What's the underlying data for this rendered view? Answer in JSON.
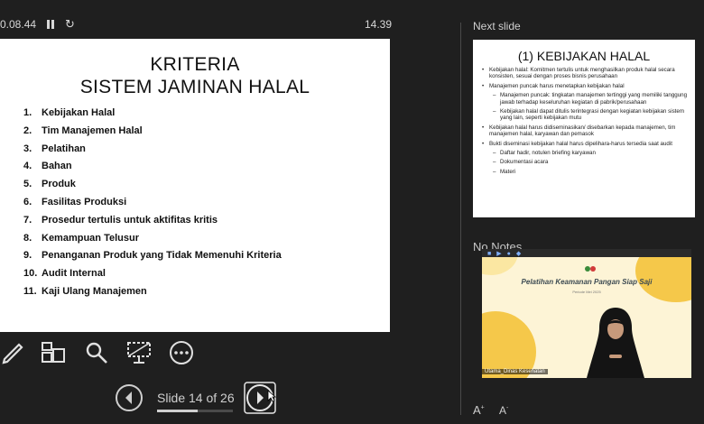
{
  "topbar": {
    "timer": "0.08.44",
    "clock": "14.39"
  },
  "current_slide": {
    "title_line1": "KRITERIA",
    "title_line2": "SISTEM JAMINAN HALAL",
    "items": [
      {
        "num": "1.",
        "text": "Kebijakan Halal"
      },
      {
        "num": "2.",
        "text": "Tim Manajemen Halal"
      },
      {
        "num": "3.",
        "text": "Pelatihan"
      },
      {
        "num": "4.",
        "text": "Bahan"
      },
      {
        "num": "5.",
        "text": "Produk"
      },
      {
        "num": "6.",
        "text": "Fasilitas Produksi"
      },
      {
        "num": "7.",
        "text": "Prosedur tertulis untuk aktifitas kritis"
      },
      {
        "num": "8.",
        "text": "Kemampuan Telusur"
      },
      {
        "num": "9.",
        "text": "Penanganan Produk yang Tidak Memenuhi Kriteria"
      },
      {
        "num": "10.",
        "text": "Audit Internal"
      },
      {
        "num": "11.",
        "text": "Kaji Ulang Manajemen"
      }
    ]
  },
  "next_slide": {
    "label": "Next slide",
    "title": "(1) KEBIJAKAN HALAL",
    "bullets": [
      "Kebijakan halal: Komitmen tertulis untuk menghasilkan produk halal secara konsisten, sesuai dengan proses bisnis perusahaan",
      "Manajemen puncak harus menetapkan kebijakan halal",
      "Manajemen puncak: tingkatan manajemen tertinggi yang memiliki tanggung jawab terhadap keseluruhan kegiatan di pabrik/perusahaan",
      "Kebijakan halal dapat ditulis terintegrasi dengan kegiatan kebijakan sistem yang lain, seperti kebijakan mutu",
      "Kebijakan halal harus didiseminasikan/ disebarkan kepada manajemen, tim manajemen halal, karyawan dan pemasok",
      "Bukti diseminasi kebijakan halal harus dipelihara-harus tersedia saat audit",
      "Daftar hadir, notulen briefing karyawan",
      "Dokumentasi acara",
      "Materi"
    ]
  },
  "notes": {
    "label": "No Notes"
  },
  "video": {
    "title": "Pelatihan Keamanan Pangan Siap Saji",
    "subtitle": "Periode Mei 2025",
    "caption": "Utama_Dinas Kesehatan"
  },
  "navigation": {
    "counter": "Slide 14 of 26",
    "current": 14,
    "total": 26
  },
  "font_controls": {
    "increase": "A",
    "decrease": "A"
  },
  "icons": {
    "pen": "pen-icon",
    "slides": "see-all-slides-icon",
    "zoom": "magnifier-icon",
    "screen": "black-screen-icon",
    "more": "more-options-icon",
    "prev": "previous-arrow-icon",
    "next": "next-arrow-icon"
  },
  "colors": {
    "background": "#1f1f1f",
    "slide": "#ffffff",
    "video_accent": "#f5c84a"
  }
}
